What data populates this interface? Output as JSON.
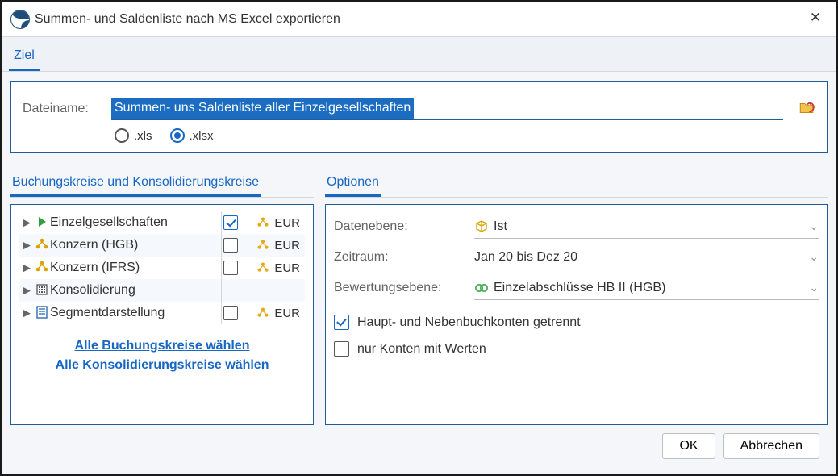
{
  "window": {
    "title": "Summen- und Saldenliste nach MS Excel exportieren",
    "close_glyph": "✕"
  },
  "tabs": {
    "ziel": "Ziel"
  },
  "file": {
    "label": "Dateiname:",
    "value": "Summen- uns Saldenliste aller Einzelgesellschaften",
    "browse_icon": "folder-open-icon",
    "formats": {
      "xls": ".xls",
      "xlsx": ".xlsx",
      "selected": "xlsx"
    }
  },
  "sections": {
    "left": "Buchungskreise und Konsolidierungskreise",
    "right": "Optionen"
  },
  "tree": [
    {
      "icon": "play",
      "iconColor": "#2ea043",
      "label": "Einzelgesellschaften",
      "checked": true,
      "currency": "EUR",
      "expandable": true
    },
    {
      "icon": "hub",
      "iconColor": "#d9a300",
      "label": "Konzern (HGB)",
      "checked": false,
      "currency": "EUR",
      "expandable": true
    },
    {
      "icon": "hub",
      "iconColor": "#d9a300",
      "label": "Konzern (IFRS)",
      "checked": false,
      "currency": "EUR",
      "expandable": true
    },
    {
      "icon": "building",
      "iconColor": "#545454",
      "label": "Konsolidierung",
      "checked": null,
      "currency": "",
      "expandable": true
    },
    {
      "icon": "segment",
      "iconColor": "#2e6db5",
      "label": "Segmentdarstellung",
      "checked": false,
      "currency": "EUR",
      "expandable": true
    }
  ],
  "tree_links": {
    "all_bk": "Alle Buchungskreise wählen",
    "all_kk": "Alle Konsolidierungskreise wählen"
  },
  "options": {
    "data_level": {
      "label": "Datenebene:",
      "value": "Ist",
      "icon": "cube",
      "iconColor": "#d9a300"
    },
    "period": {
      "label": "Zeitraum:",
      "value": "Jan 20 bis Dez 20"
    },
    "valuation": {
      "label": "Bewertungsebene:",
      "value": "Einzelabschlüsse HB II (HGB)",
      "icon": "circles",
      "iconColor": "#3aa648"
    },
    "split_accounts": {
      "label": "Haupt- und Nebenbuchkonten getrennt",
      "checked": true
    },
    "only_with_values": {
      "label": "nur Konten mit Werten",
      "checked": false
    }
  },
  "footer": {
    "ok": "OK",
    "cancel": "Abbrechen"
  }
}
